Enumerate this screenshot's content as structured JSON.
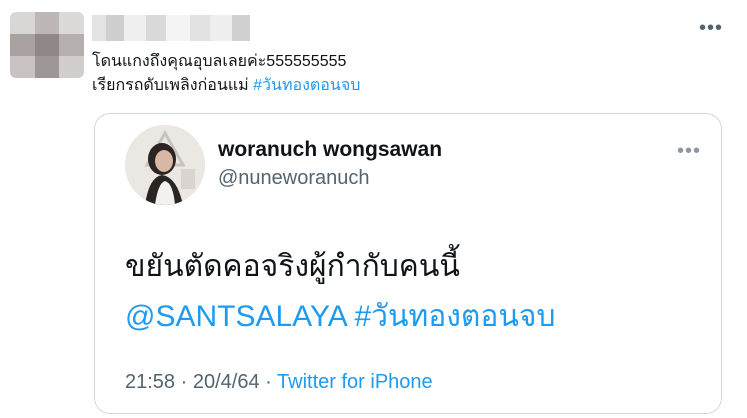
{
  "tweet": {
    "more_icon": "more-horizontal-icon",
    "text_line1": "โดนแกงถึงคุณอุบลเลยค่ะ555555555",
    "text_line2_prefix": "เรียกรถดับเพลิงก่อนแม่ ",
    "text_line2_hashtag": "#วันทองตอนจบ",
    "accent_color": "#1d9bf0"
  },
  "quote": {
    "name": "woranuch wongsawan",
    "handle": "@nuneworanuch",
    "more_icon": "more-horizontal-icon",
    "text_line1": "ขยันตัดคอจริงผู้กำกับคนนี้",
    "mention": "@SANTSALAYA",
    "hashtag": "#วันทองตอนจบ",
    "time": "21:58",
    "date": "20/4/64",
    "separator": "·",
    "source": "Twitter for iPhone"
  }
}
